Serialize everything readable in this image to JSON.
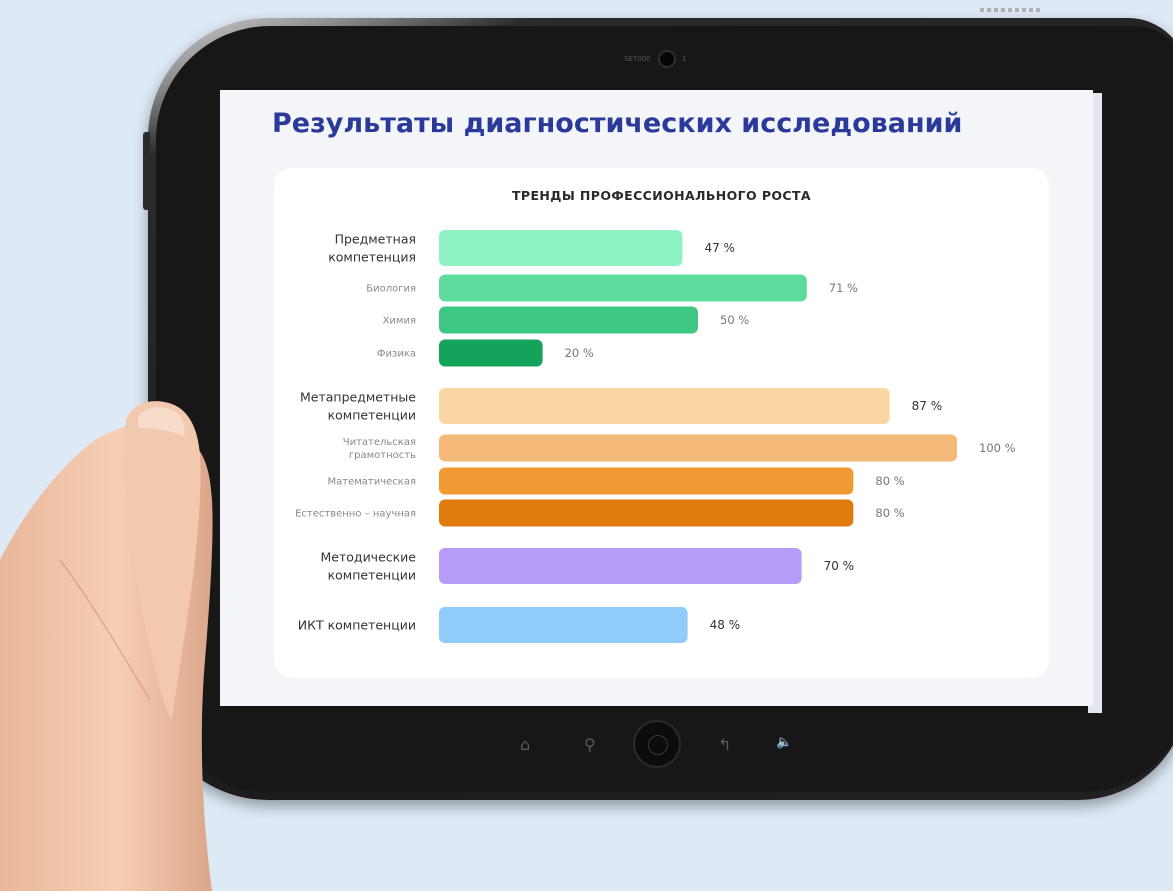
{
  "page": {
    "title": "Результаты диагностических исследований",
    "device_top_text": "SE7000",
    "device_cam_text": "1"
  },
  "softkeys": [
    {
      "icon": "home-icon",
      "glyph": "⌂"
    },
    {
      "icon": "search-icon",
      "glyph": "⚲"
    },
    {
      "icon": "back-icon",
      "glyph": "↰"
    },
    {
      "icon": "volume-icon",
      "glyph": "🔈"
    }
  ],
  "chart_data": {
    "type": "bar",
    "orientation": "horizontal",
    "title": "ТРЕНДЫ ПРОФЕССИОНАЛЬНОГО РОСТА",
    "xlim": [
      0,
      100
    ],
    "grid": false,
    "unit_suffix": " %",
    "categories": [
      "Предметная компетенция",
      "Биология",
      "Химия",
      "Физика",
      "Метапредметные компетенции",
      "Читательская грамотность",
      "Математическая",
      "Естественно – научная",
      "Методические компетенции",
      "ИКТ компетенции"
    ],
    "category_lines": [
      [
        "Предметная",
        "компетенция"
      ],
      [
        "Биология"
      ],
      [
        "Химия"
      ],
      [
        "Физика"
      ],
      [
        "Метапредметные",
        "компетенции"
      ],
      [
        "Читательская",
        "грамотность"
      ],
      [
        "Математическая"
      ],
      [
        "Естественно – научная"
      ],
      [
        "Методические",
        "компетенции"
      ],
      [
        "ИКТ компетенции"
      ]
    ],
    "values": [
      47,
      71,
      50,
      20,
      87,
      100,
      80,
      80,
      70,
      48
    ],
    "value_labels": [
      "47 %",
      "71 %",
      "50 %",
      "20 %",
      "87 %",
      "100 %",
      "80 %",
      "80 %",
      "70 %",
      "48 %"
    ],
    "main": [
      true,
      false,
      false,
      false,
      true,
      false,
      false,
      false,
      true,
      true
    ],
    "colors": [
      "#8ef3c4",
      "#5edc9e",
      "#3fc883",
      "#14a35a",
      "#fbd6a5",
      "#f4b978",
      "#f09a33",
      "#e07b10",
      "#b59cf7",
      "#90cbfa"
    ]
  }
}
